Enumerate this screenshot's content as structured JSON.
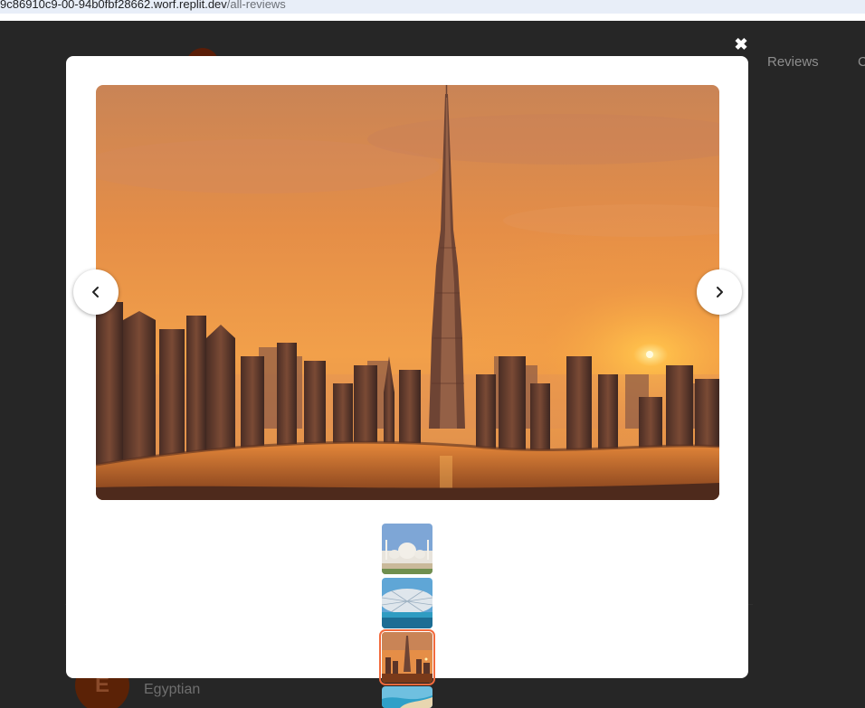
{
  "browser": {
    "url_host": "9c86910c9-00-94b0fbf28662.worf.replit.dev",
    "url_path": "/all-reviews"
  },
  "background_page": {
    "nav_reviews": "Reviews",
    "nav_more": "C",
    "reviewer_initial": "E",
    "reviewer_name": "Egyptian"
  },
  "gallery": {
    "close_icon": "close-icon",
    "prev_icon": "chevron-left-icon",
    "next_icon": "chevron-right-icon",
    "main_image": "burj-khalifa-sunset",
    "thumbnails": [
      {
        "name": "sheikh-zayed-mosque",
        "active": false
      },
      {
        "name": "louvre-abu-dhabi",
        "active": false
      },
      {
        "name": "burj-khalifa-sunset",
        "active": true
      },
      {
        "name": "beach-coast",
        "active": false
      }
    ],
    "active_color": "#f26a3c"
  }
}
